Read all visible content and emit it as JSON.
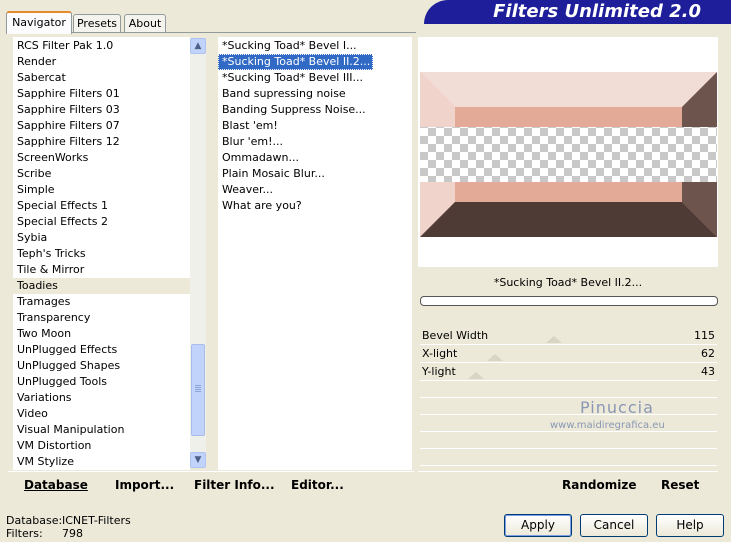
{
  "tabs": [
    "Navigator",
    "Presets",
    "About"
  ],
  "banner": "Filters Unlimited 2.0",
  "categories": [
    "RCS Filter Pak 1.0",
    "Render",
    "Sabercat",
    "Sapphire Filters 01",
    "Sapphire Filters 03",
    "Sapphire Filters 07",
    "Sapphire Filters 12",
    "ScreenWorks",
    "Scribe",
    "Simple",
    "Special Effects 1",
    "Special Effects 2",
    "Sybia",
    "Teph's Tricks",
    "Tile & Mirror",
    "Toadies",
    "Tramages",
    "Transparency",
    "Two Moon",
    "UnPlugged Effects",
    "UnPlugged Shapes",
    "UnPlugged Tools",
    "Variations",
    "Video",
    "Visual Manipulation",
    "VM Distortion",
    "VM Stylize"
  ],
  "selected_category_index": 15,
  "filters": [
    "*Sucking Toad*  Bevel I...",
    "*Sucking Toad*  Bevel II.2...",
    "*Sucking Toad*  Bevel III...",
    "Band supressing noise",
    "Banding Suppress Noise...",
    "Blast 'em!",
    "Blur 'em!...",
    "Ommadawn...",
    "Plain Mosaic Blur...",
    "Weaver...",
    "What are you?"
  ],
  "selected_filter_index": 1,
  "filter_title": "*Sucking Toad*  Bevel II.2...",
  "params": [
    {
      "label": "Bevel Width",
      "value": "115",
      "level": 0.45
    },
    {
      "label": "X-light",
      "value": "62",
      "level": 0.24
    },
    {
      "label": "Y-light",
      "value": "43",
      "level": 0.17
    }
  ],
  "watermark": {
    "name": "Pinuccia",
    "site": "www.maidiregrafica.eu"
  },
  "toolbar": {
    "database": "Database",
    "import": "Import...",
    "filter_info": "Filter Info...",
    "editor": "Editor...",
    "randomize": "Randomize",
    "reset": "Reset"
  },
  "status": {
    "db_label": "Database:",
    "db_value": "ICNET-Filters",
    "filters_label": "Filters:",
    "filters_value": "798"
  },
  "buttons": {
    "apply": "Apply",
    "cancel": "Cancel",
    "help": "Help"
  },
  "colors": {
    "selection": "#316ac5",
    "banner": "#1e1e9a",
    "bevel_light": "#f2ddd6",
    "bevel_mid": "#e3aa98",
    "bevel_dark": "#4e3b36",
    "bevel_side": "#6d544c"
  }
}
